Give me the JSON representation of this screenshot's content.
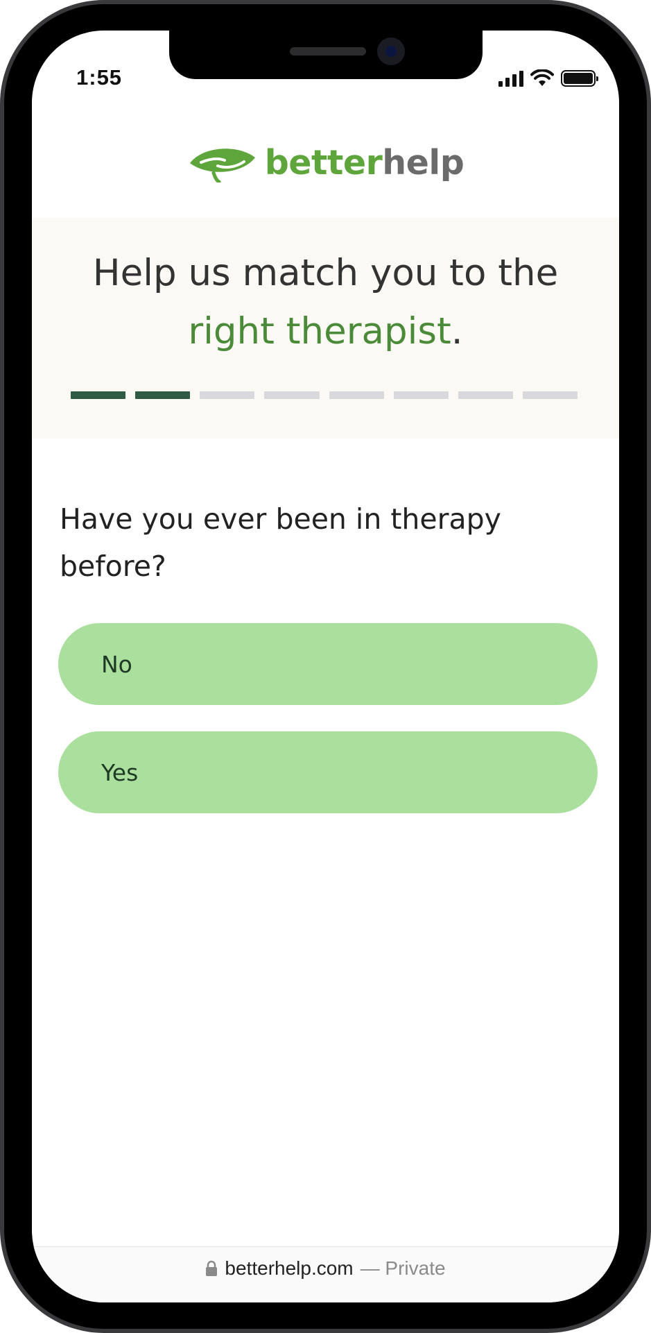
{
  "status_bar": {
    "time": "1:55"
  },
  "brand": {
    "logo_part1": "better",
    "logo_part2": "help",
    "colors": {
      "green": "#5ea53b",
      "gray": "#6b6b6b"
    }
  },
  "hero": {
    "title_line1": "Help us match you to the",
    "title_accent": "right therapist",
    "title_end": ".",
    "progress": {
      "total_steps": 8,
      "completed_steps": 2
    }
  },
  "question": {
    "text": "Have you ever been in therapy before?",
    "options": [
      {
        "label": "No"
      },
      {
        "label": "Yes"
      }
    ]
  },
  "browser": {
    "domain": "betterhelp.com",
    "privacy_label": "— Private"
  }
}
